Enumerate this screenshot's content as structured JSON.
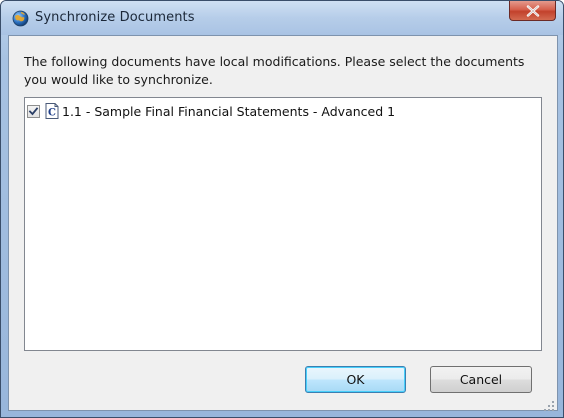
{
  "window": {
    "title": "Synchronize Documents",
    "app_icon": "globe-icon",
    "close_icon": "close-icon"
  },
  "dialog": {
    "message": "The following documents have local modifications. Please select the documents you would like to synchronize.",
    "documents": [
      {
        "checked": true,
        "icon": "document-c-icon",
        "label": "1.1 - Sample Final Financial Statements - Advanced 1"
      }
    ]
  },
  "buttons": {
    "ok_label": "OK",
    "cancel_label": "Cancel"
  },
  "colors": {
    "titlebar": "#b6cde9",
    "close_button": "#d6604d",
    "client_bg": "#f0f0f0",
    "default_button_border": "#3c7fb1"
  }
}
